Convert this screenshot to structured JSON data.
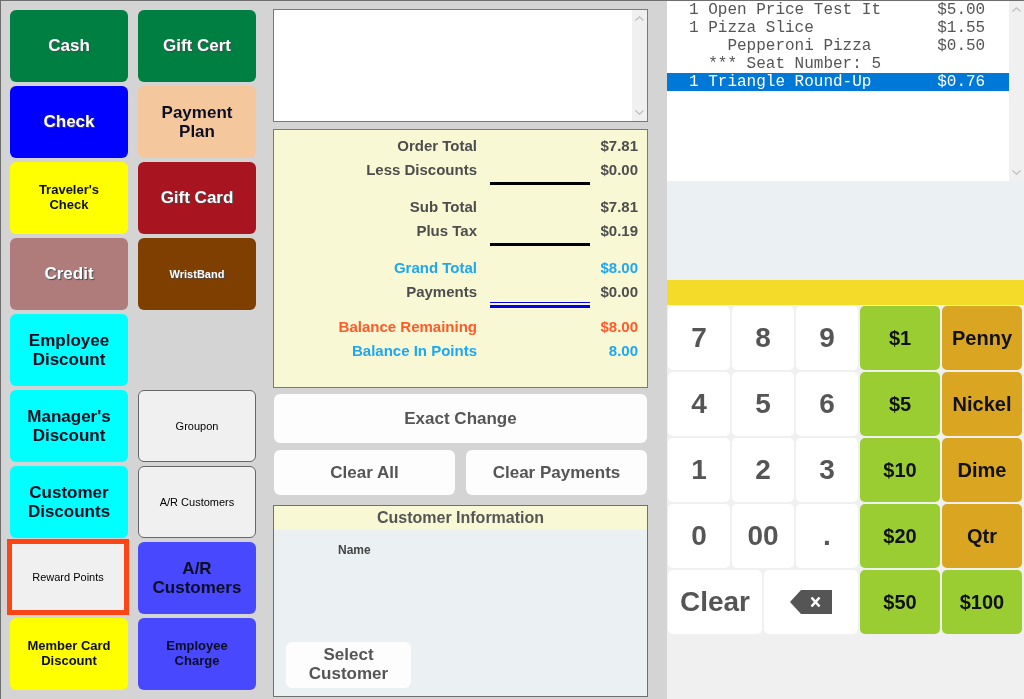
{
  "tender_panel": {
    "column_1": [
      {
        "label": "Cash",
        "kind": "light",
        "color": "#007f42",
        "selected": false
      },
      {
        "label": "Check",
        "kind": "light",
        "color": "#0000ff",
        "selected": false
      },
      {
        "label": "Traveler's Check",
        "kind": "compact",
        "color": "#ffff00",
        "selected": false
      },
      {
        "label": "Credit",
        "kind": "light",
        "color": "#b07b7b",
        "selected": false
      },
      {
        "label": "Employee Discount",
        "kind": "dark",
        "color": "#00ffff",
        "selected": false
      },
      {
        "label": "Manager's Discount",
        "kind": "dark",
        "color": "#00ffff",
        "selected": false
      },
      {
        "label": "Customer Discounts",
        "kind": "dark",
        "color": "#00ffff",
        "selected": false
      },
      {
        "label": "Reward Points",
        "kind": "plain",
        "color": "#f0f0f0",
        "selected": true
      },
      {
        "label": "Member Card Discount",
        "kind": "compact",
        "color": "#ffff00",
        "selected": false
      }
    ],
    "column_2_top": [
      {
        "label": "Gift Cert",
        "kind": "light",
        "color": "#007f42",
        "selected": false
      },
      {
        "label": "Payment Plan",
        "kind": "dark",
        "color": "#f4c89c",
        "selected": false
      },
      {
        "label": "Gift Card",
        "kind": "light",
        "color": "#a8141f",
        "selected": false
      },
      {
        "label": "WristBand",
        "kind": "mini",
        "color": "#7f3f00",
        "selected": false
      }
    ],
    "column_2_bottom": [
      {
        "label": "Groupon",
        "kind": "plain",
        "color": "#f0f0f0",
        "selected": false
      },
      {
        "label": "A/R Customers",
        "kind": "plain",
        "color": "#f0f0f0",
        "selected": false
      },
      {
        "label": "A/R Customers",
        "kind": "dark",
        "color": "#4848ff",
        "selected": false
      },
      {
        "label": "Employee Charge",
        "kind": "compact",
        "color": "#4848ff",
        "selected": false
      }
    ]
  },
  "totals": [
    {
      "kind": "amount",
      "label": "Order Total",
      "value": "$7.81",
      "color": "#4d4d4d"
    },
    {
      "kind": "amount",
      "label": "Less Discounts",
      "value": "$0.00",
      "color": "#4d4d4d"
    },
    {
      "kind": "rule"
    },
    {
      "kind": "amount",
      "label": "Sub Total",
      "value": "$7.81",
      "color": "#4d4d4d"
    },
    {
      "kind": "amount",
      "label": "Plus Tax",
      "value": "$0.19",
      "color": "#4d4d4d"
    },
    {
      "kind": "rule"
    },
    {
      "kind": "amount",
      "label": "Grand Total",
      "value": "$8.00",
      "color": "#1ea7f0"
    },
    {
      "kind": "amount",
      "label": "Payments",
      "value": "$0.00",
      "color": "#4d4d4d"
    },
    {
      "kind": "doublerule"
    },
    {
      "kind": "amount",
      "label": "Balance Remaining",
      "value": "$8.00",
      "color": "#ff5a2a"
    },
    {
      "kind": "amount",
      "label": "Balance In Points",
      "value": "8.00",
      "color": "#1ea7f0"
    }
  ],
  "exact_change_button": "Exact Change",
  "clear_buttons": [
    "Clear All",
    "Clear Payments"
  ],
  "customer_info": {
    "title": "Customer Information",
    "name_label": "Name",
    "select_button": "Select Customer"
  },
  "order_items": [
    {
      "qty": "1",
      "name": "Open Price Test It",
      "price": "$5.00",
      "selected": false
    },
    {
      "qty": "1",
      "name": "Pizza Slice",
      "price": "$1.55",
      "selected": false,
      "children": [
        {
          "name": "Pepperoni Pizza",
          "price": "$0.50",
          "selected": false
        }
      ],
      "note": "*** Seat Number: 5"
    },
    {
      "qty": "1",
      "name": "Triangle Round-Up",
      "price": "$0.76",
      "selected": true
    }
  ],
  "keypad": {
    "rows": [
      {
        "keys": [
          {
            "label": "7",
            "kind": "digit",
            "color": "#ffffff"
          },
          {
            "label": "8",
            "kind": "digit",
            "color": "#ffffff"
          },
          {
            "label": "9",
            "kind": "digit",
            "color": "#ffffff"
          },
          {
            "label": "$1",
            "kind": "cash",
            "color": "#9acd32"
          },
          {
            "label": "Penny",
            "kind": "coin",
            "color": "#daa520"
          }
        ]
      },
      {
        "keys": [
          {
            "label": "4",
            "kind": "digit",
            "color": "#ffffff"
          },
          {
            "label": "5",
            "kind": "digit",
            "color": "#ffffff"
          },
          {
            "label": "6",
            "kind": "digit",
            "color": "#ffffff"
          },
          {
            "label": "$5",
            "kind": "cash",
            "color": "#9acd32"
          },
          {
            "label": "Nickel",
            "kind": "coin",
            "color": "#daa520"
          }
        ]
      },
      {
        "keys": [
          {
            "label": "1",
            "kind": "digit",
            "color": "#ffffff"
          },
          {
            "label": "2",
            "kind": "digit",
            "color": "#ffffff"
          },
          {
            "label": "3",
            "kind": "digit",
            "color": "#ffffff"
          },
          {
            "label": "$10",
            "kind": "cash",
            "color": "#9acd32"
          },
          {
            "label": "Dime",
            "kind": "coin",
            "color": "#daa520"
          }
        ]
      },
      {
        "keys": [
          {
            "label": "0",
            "kind": "digit",
            "color": "#ffffff"
          },
          {
            "label": "00",
            "kind": "digit",
            "color": "#ffffff"
          },
          {
            "label": ".",
            "kind": "digit",
            "color": "#ffffff"
          },
          {
            "label": "$20",
            "kind": "cash",
            "color": "#9acd32"
          },
          {
            "label": "Qtr",
            "kind": "coin",
            "color": "#daa520"
          }
        ]
      },
      {
        "keys": [
          {
            "label": "Clear",
            "kind": "clear",
            "color": "#ffffff"
          },
          {
            "kind": "backspace",
            "color": "#ffffff"
          },
          {
            "label": "$50",
            "kind": "cash",
            "color": "#9acd32"
          },
          {
            "label": "$100",
            "kind": "cash",
            "color": "#9acd32"
          }
        ]
      }
    ]
  }
}
